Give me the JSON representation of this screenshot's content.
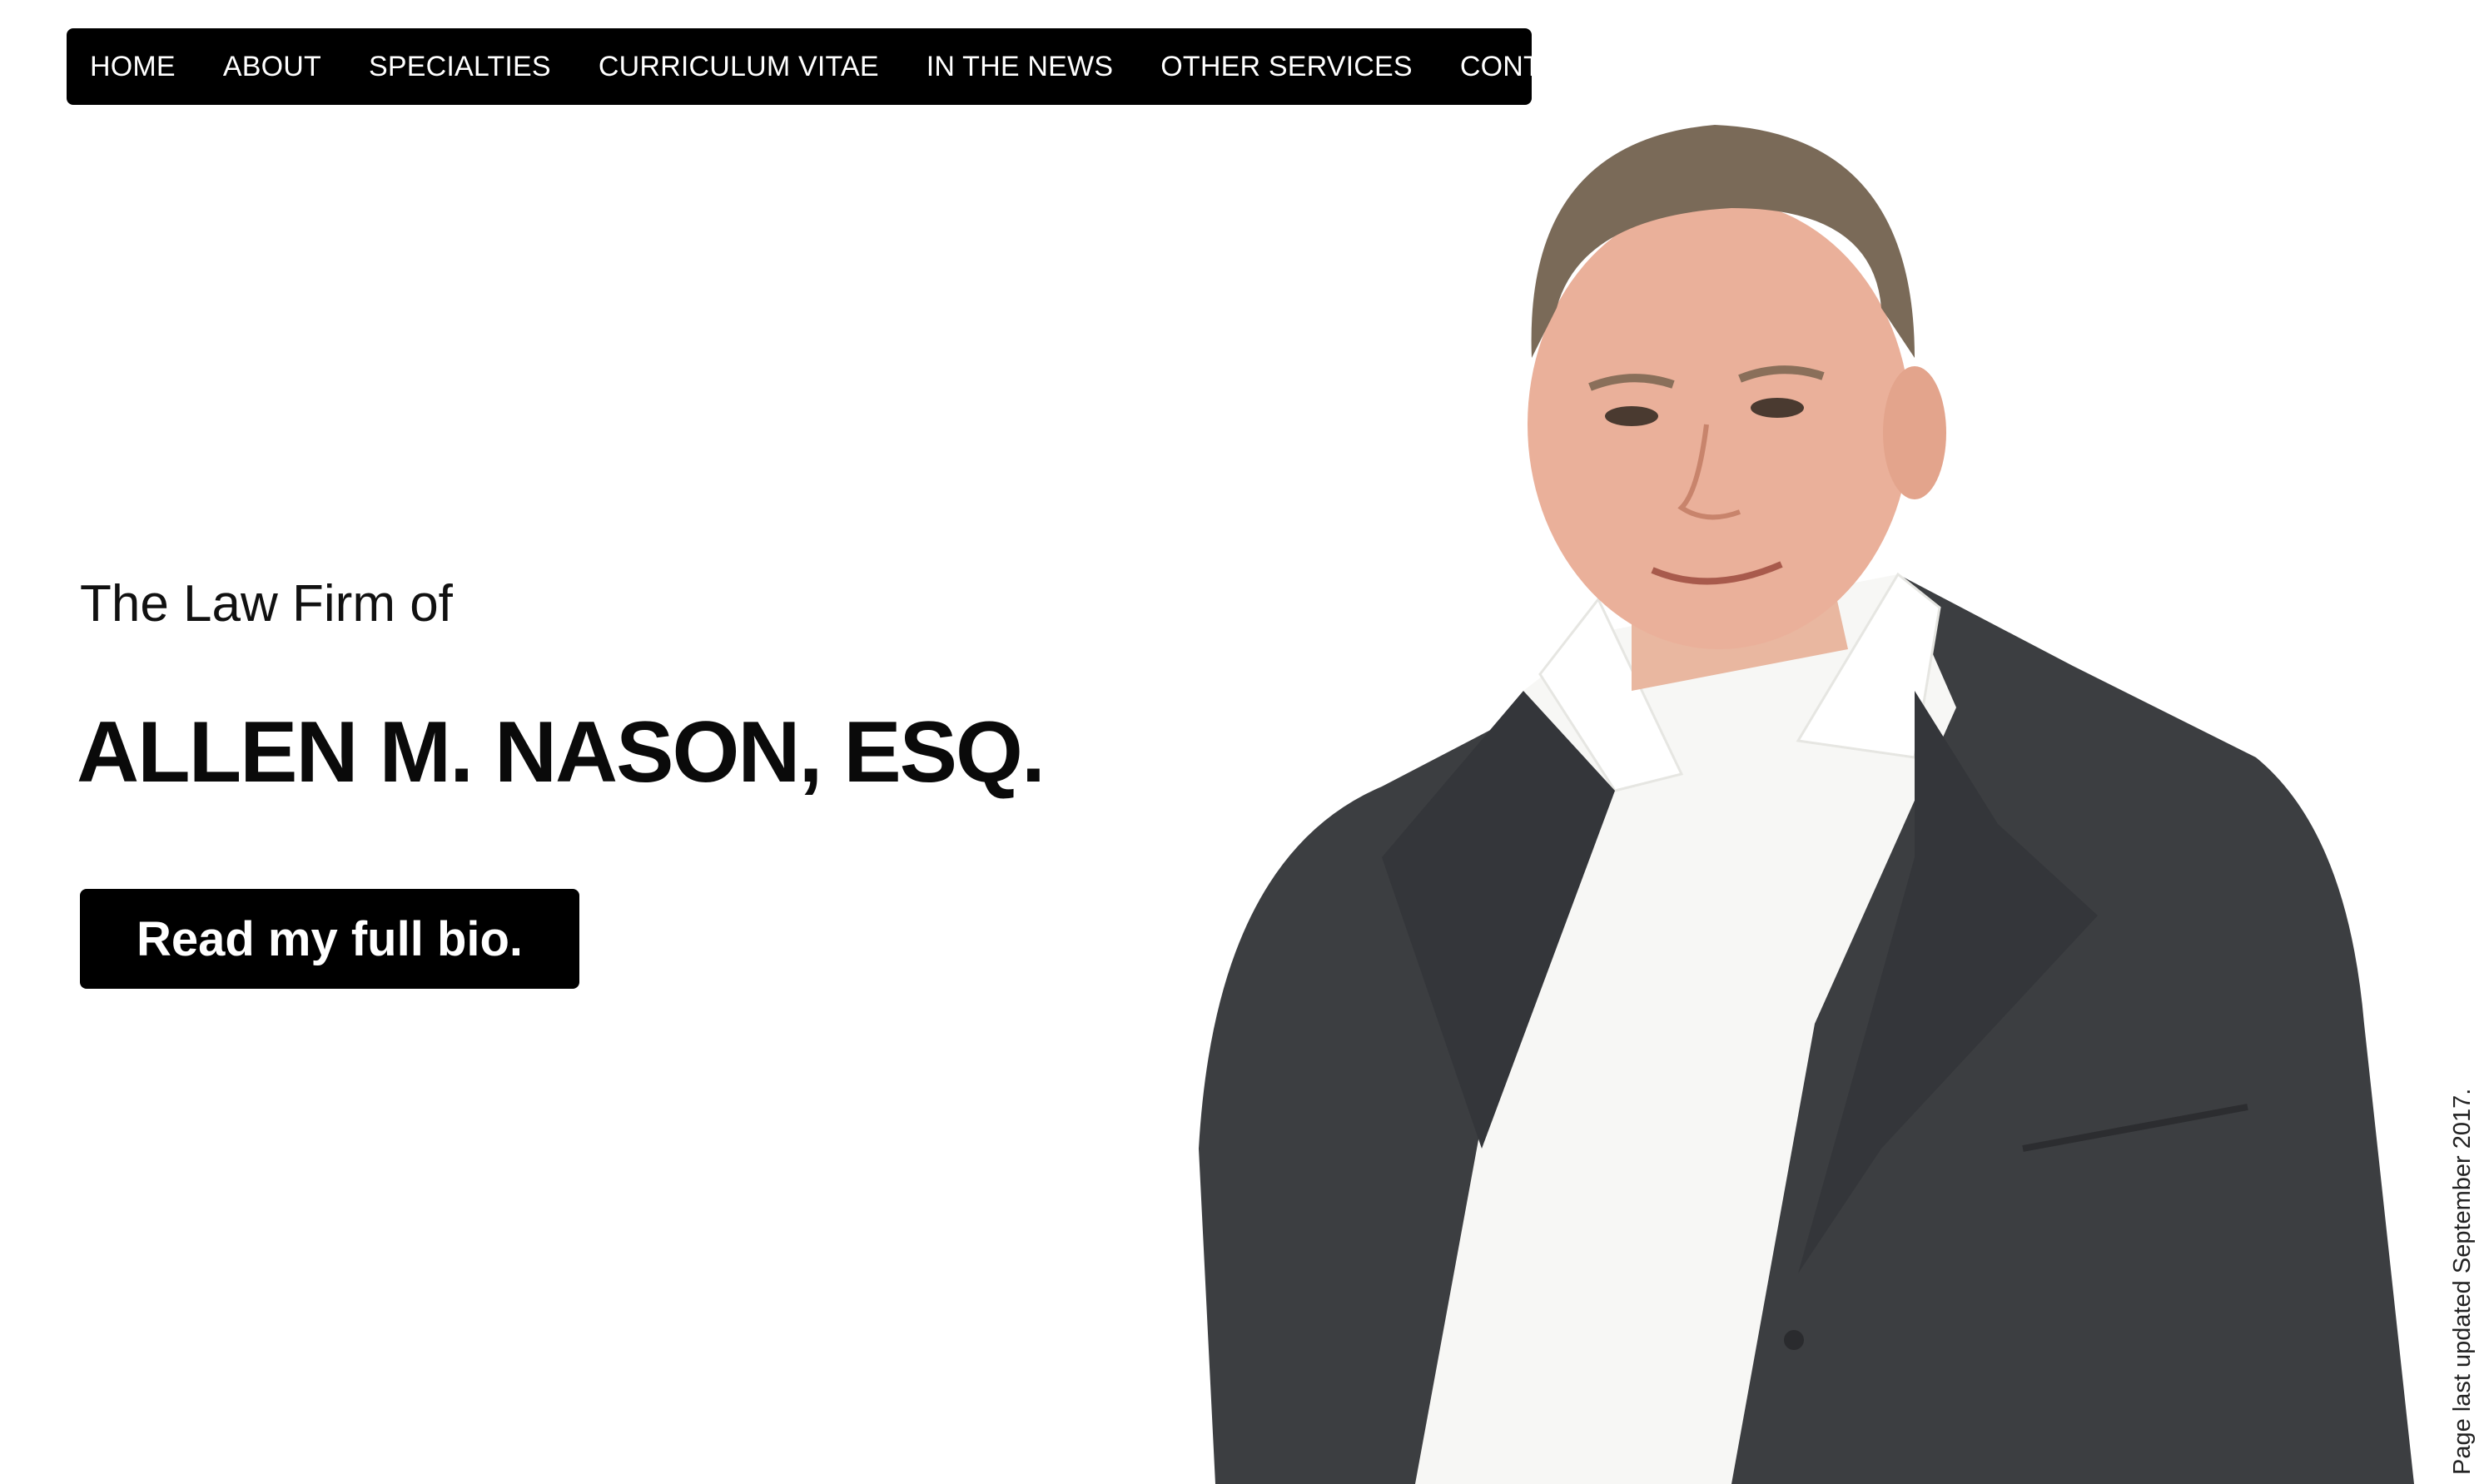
{
  "nav": {
    "items": [
      {
        "label": "HOME"
      },
      {
        "label": "ABOUT"
      },
      {
        "label": "SPECIALTIES"
      },
      {
        "label": "CURRICULUM VITAE"
      },
      {
        "label": "IN THE NEWS"
      },
      {
        "label": "OTHER SERVICES"
      },
      {
        "label": "CONTACT"
      }
    ]
  },
  "hero": {
    "tagline": "The Law Firm of",
    "name": "ALLEN M. NASON, ESQ.",
    "bio_button_label": "Read my full bio."
  },
  "footer": {
    "updated_note": "Page last updated September 2017."
  },
  "colors": {
    "nav_background": "#000000",
    "nav_text": "#ffffff",
    "button_background": "#000000",
    "page_background": "#ffffff",
    "suit": "#3c3e41",
    "shirt": "#f7f7f5",
    "skin": "#e6a88e",
    "hair": "#7a6a58"
  },
  "icons": {
    "portrait": "attorney-portrait-photo"
  }
}
